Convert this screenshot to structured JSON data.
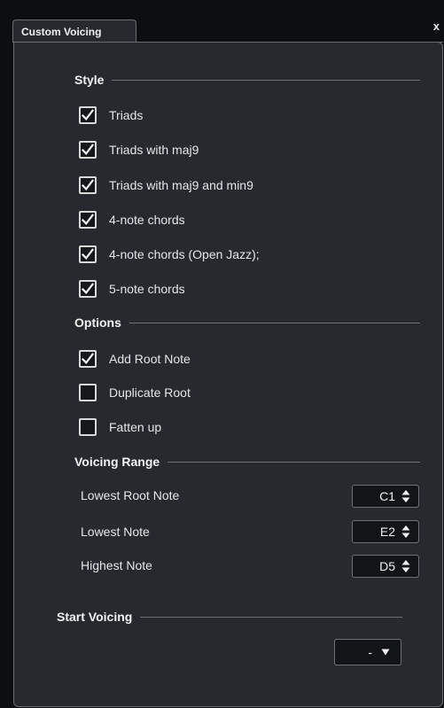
{
  "tab": {
    "title": "Custom Voicing",
    "close_label": "x"
  },
  "style": {
    "title": "Style",
    "items": [
      {
        "label": "Triads",
        "checked": true
      },
      {
        "label": "Triads with maj9",
        "checked": true
      },
      {
        "label": "Triads with maj9 and min9",
        "checked": true
      },
      {
        "label": "4-note chords",
        "checked": true
      },
      {
        "label": "4-note chords (Open Jazz);",
        "checked": true
      },
      {
        "label": "5-note chords",
        "checked": true
      }
    ]
  },
  "options": {
    "title": "Options",
    "items": [
      {
        "label": "Add Root Note",
        "checked": true
      },
      {
        "label": "Duplicate Root",
        "checked": false
      },
      {
        "label": "Fatten up",
        "checked": false
      }
    ]
  },
  "voicing_range": {
    "title": "Voicing Range",
    "lowest_root_note": {
      "label": "Lowest Root Note",
      "value": "C1"
    },
    "lowest_note": {
      "label": "Lowest Note",
      "value": "E2"
    },
    "highest_note": {
      "label": "Highest Note",
      "value": "D5"
    }
  },
  "start_voicing": {
    "title": "Start Voicing",
    "value": "-"
  },
  "icons": {
    "check": "checkmark-icon",
    "spinner": "up-down-arrows-icon",
    "dropdown": "triangle-down-icon"
  },
  "colors": {
    "background": "#262a2e",
    "border": "#6a6e73",
    "text": "#e6e6e6"
  }
}
